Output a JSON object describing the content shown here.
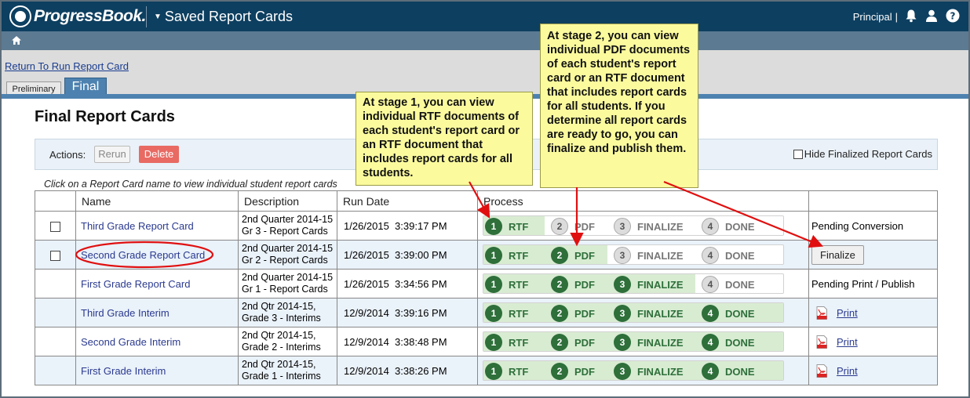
{
  "header": {
    "logo_text": "ProgressBook.",
    "app_title": "Saved Report Cards",
    "role": "Principal",
    "role_sep": "|"
  },
  "nav": {
    "return_link": "Return To Run Report Card"
  },
  "tabs": [
    {
      "label": "Preliminary",
      "active": false
    },
    {
      "label": "Final",
      "active": true
    }
  ],
  "page_title": "Final Report Cards",
  "actions": {
    "label": "Actions:",
    "rerun": "Rerun",
    "delete": "Delete",
    "hide_finalized": "Hide Finalized Report Cards"
  },
  "hint": "Click on a Report Card name to view individual student report cards",
  "table": {
    "headers": [
      "Name",
      "Description",
      "Run Date",
      "Process"
    ],
    "rows": [
      {
        "name": "Third Grade Report Card",
        "desc1": "2nd Quarter 2014-15",
        "desc2": "Gr 3 - Report Cards",
        "date": "1/26/2015  3:39:17 PM",
        "stage": 1,
        "status": "Pending Conversion",
        "checkbox": true
      },
      {
        "name": "Second Grade Report Card",
        "desc1": "2nd Quarter 2014-15",
        "desc2": "Gr 2 - Report Cards",
        "date": "1/26/2015  3:39:00 PM",
        "stage": 2,
        "status": "Finalize",
        "checkbox": true
      },
      {
        "name": "First Grade Report Card",
        "desc1": "2nd Quarter 2014-15",
        "desc2": "Gr 1 - Report Cards",
        "date": "1/26/2015  3:34:56 PM",
        "stage": 3,
        "status": "Pending Print / Publish",
        "checkbox": false
      },
      {
        "name": "Third Grade Interim",
        "desc1": "2nd Qtr 2014-15,",
        "desc2": "Grade 3 - Interims",
        "date": "12/9/2014  3:39:16 PM",
        "stage": 4,
        "status": "Print",
        "checkbox": false
      },
      {
        "name": "Second Grade Interim",
        "desc1": "2nd Qtr 2014-15,",
        "desc2": "Grade 2 - Interims",
        "date": "12/9/2014  3:38:48 PM",
        "stage": 4,
        "status": "Print",
        "checkbox": false
      },
      {
        "name": "First Grade Interim",
        "desc1": "2nd Qtr 2014-15,",
        "desc2": "Grade 1 - Interims",
        "date": "12/9/2014  3:38:26 PM",
        "stage": 4,
        "status": "Print",
        "checkbox": false
      }
    ]
  },
  "process_steps": [
    {
      "num": "1",
      "label": "RTF"
    },
    {
      "num": "2",
      "label": "PDF"
    },
    {
      "num": "3",
      "label": "FINALIZE"
    },
    {
      "num": "4",
      "label": "DONE"
    }
  ],
  "callouts": {
    "stage1": "At stage 1, you can view individual RTF documents of each student's report card or an RTF document that includes report cards for all students.",
    "stage2": "At stage 2, you can view individual PDF documents of each student's report card or an RTF document that includes report cards for all students. If you determine all report cards are ready to go, you can finalize and publish them."
  },
  "colors": {
    "topbar": "#0d3f60",
    "navbar": "#5c7a92",
    "tab_active": "#4d82b0",
    "step_done": "#2e6f3a",
    "step_fill": "#d8ecd2",
    "delete_button": "#e86a63",
    "callout_bg": "#fbfb9e",
    "annotation_red": "#e01010"
  }
}
